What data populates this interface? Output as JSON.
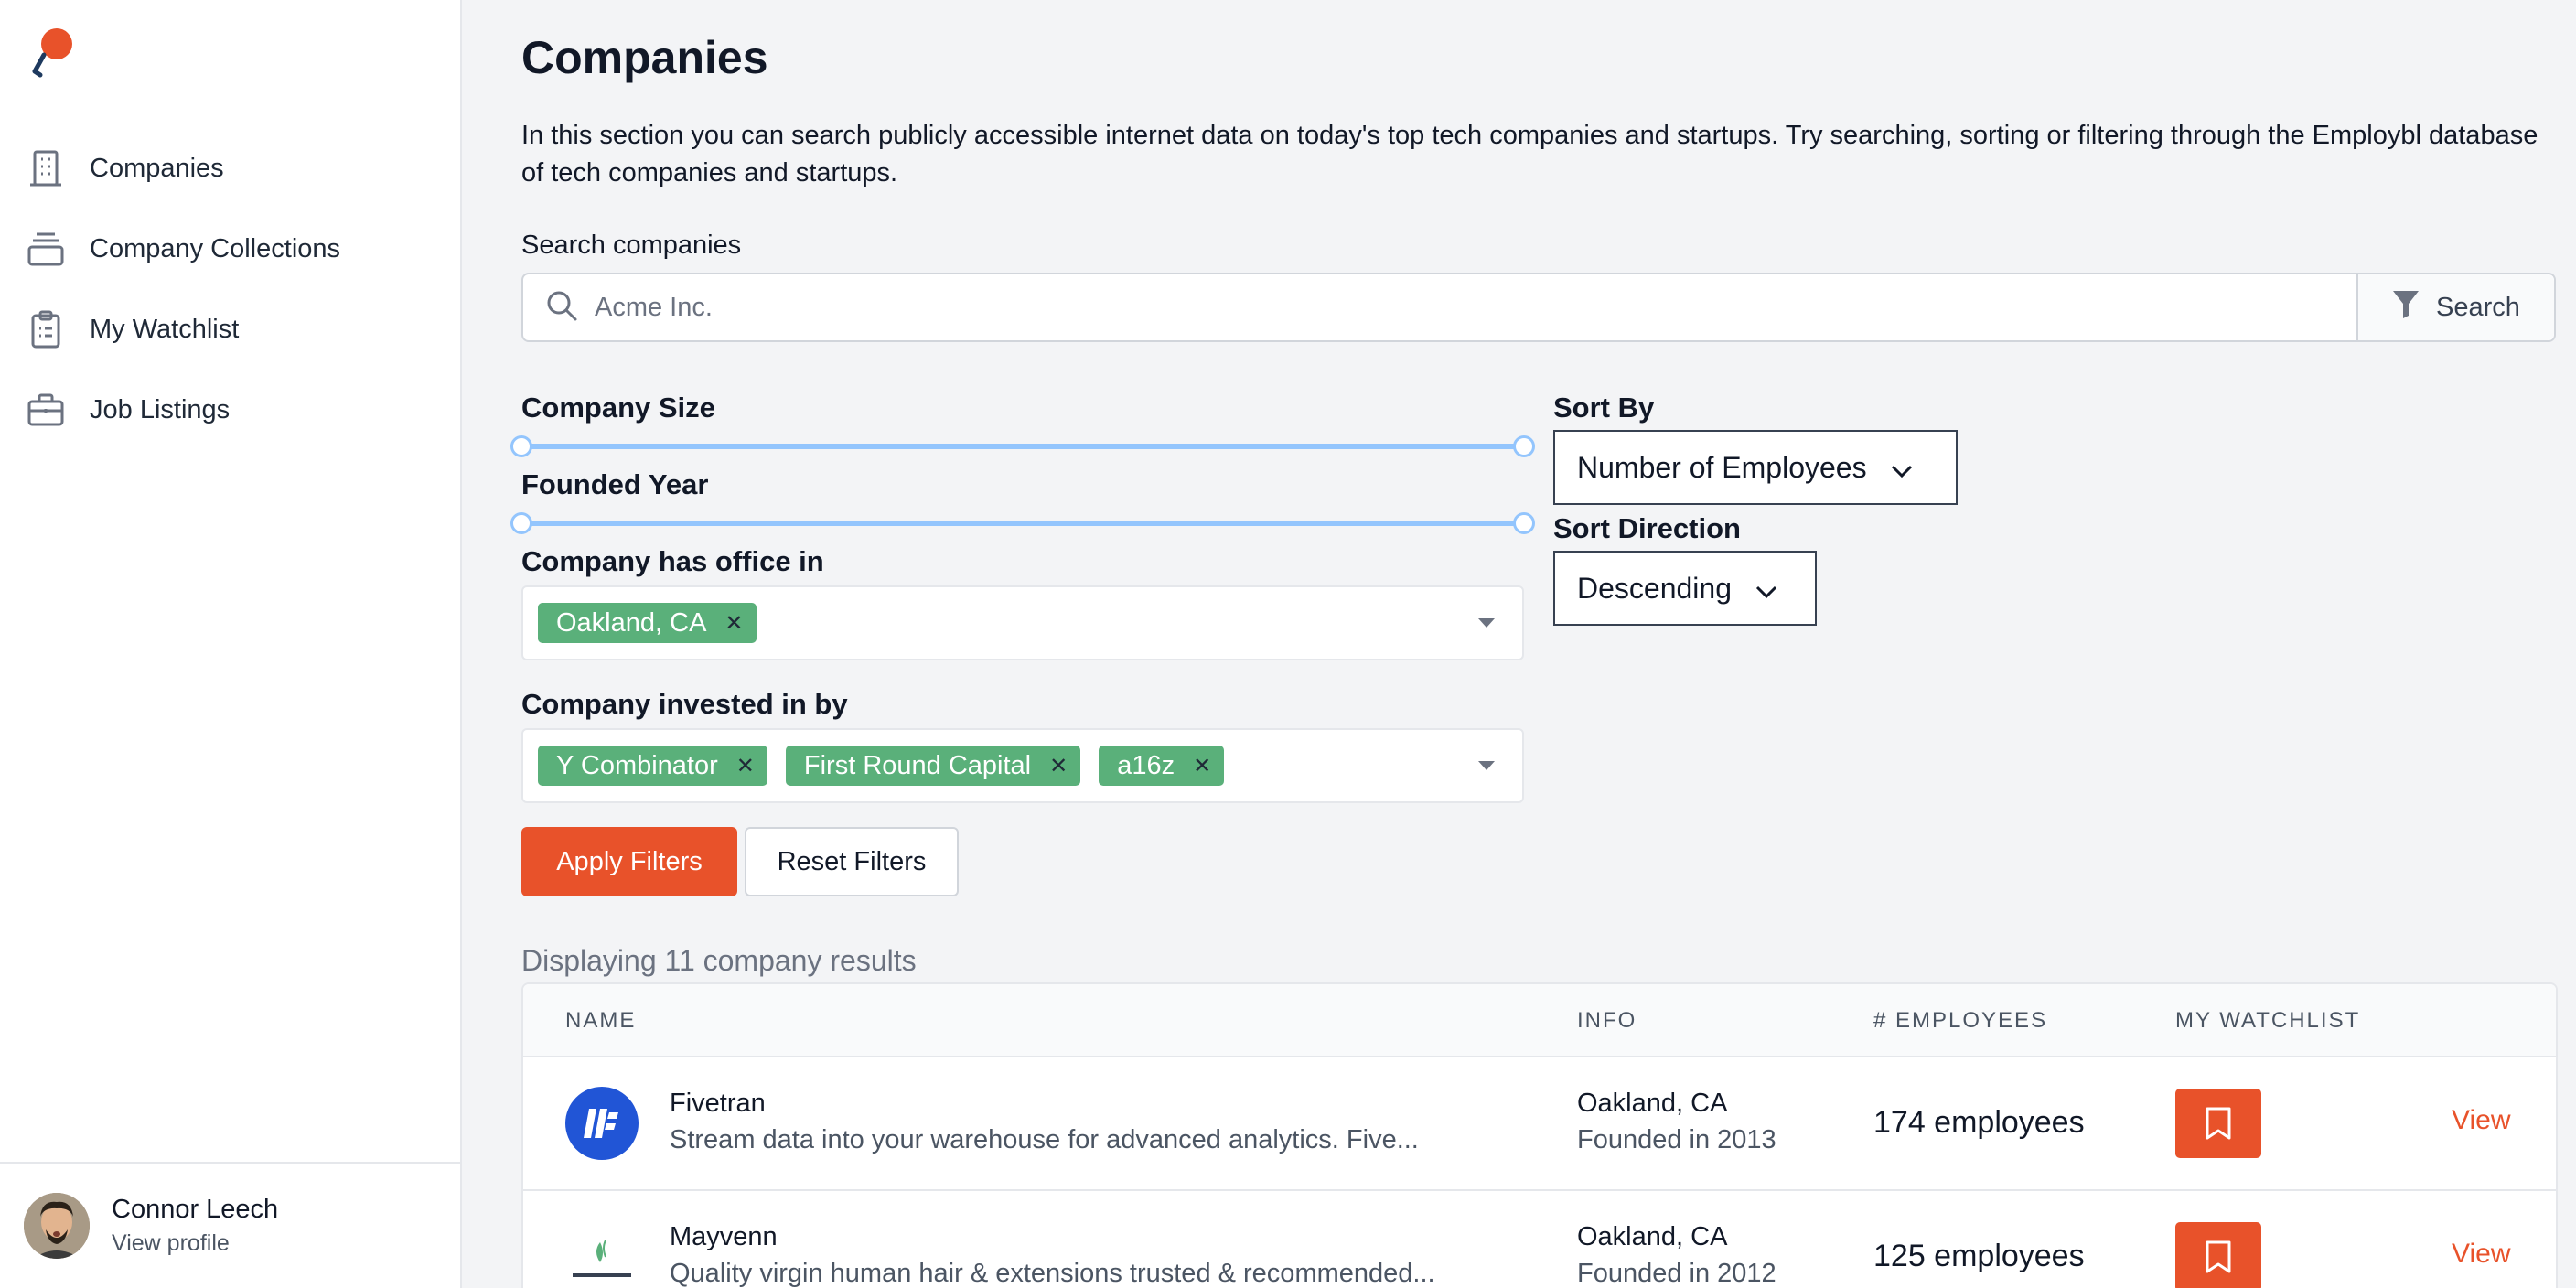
{
  "sidebar": {
    "items": [
      {
        "label": "Companies",
        "icon": "building-icon"
      },
      {
        "label": "Company Collections",
        "icon": "collection-icon"
      },
      {
        "label": "My Watchlist",
        "icon": "clipboard-icon"
      },
      {
        "label": "Job Listings",
        "icon": "briefcase-icon"
      }
    ],
    "profile": {
      "name": "Connor Leech",
      "link": "View profile"
    }
  },
  "main": {
    "title": "Companies",
    "intro": "In this section you can search publicly accessible internet data on today's top tech companies and startups. Try searching, sorting or filtering through the Employbl database of tech companies and startups.",
    "search": {
      "label": "Search companies",
      "placeholder": "Acme Inc.",
      "button": "Search"
    },
    "filters": {
      "company_size": "Company Size",
      "founded_year": "Founded Year",
      "office_label": "Company has office in",
      "office_chips": [
        "Oakland, CA"
      ],
      "invested_label": "Company invested in by",
      "invested_chips": [
        "Y Combinator",
        "First Round Capital",
        "a16z"
      ],
      "sort_by_label": "Sort By",
      "sort_by_value": "Number of Employees",
      "sort_direction_label": "Sort Direction",
      "sort_direction_value": "Descending",
      "apply": "Apply Filters",
      "reset": "Reset Filters"
    },
    "results_count": "Displaying 11 company results",
    "table": {
      "headers": [
        "NAME",
        "INFO",
        "# EMPLOYEES",
        "MY WATCHLIST"
      ],
      "rows": [
        {
          "name": "Fivetran",
          "description": "Stream data into your warehouse for advanced analytics. Five...",
          "location": "Oakland, CA",
          "founded": "Founded in 2013",
          "employees": "174 employees",
          "action": "View"
        },
        {
          "name": "Mayvenn",
          "description": "Quality virgin human hair & extensions trusted & recommended...",
          "location": "Oakland, CA",
          "founded": "Founded in 2012",
          "employees": "125 employees",
          "action": "View"
        }
      ]
    }
  },
  "colors": {
    "accent": "#e8522a",
    "chip": "#5ab07a",
    "slider": "#93c5fd"
  }
}
